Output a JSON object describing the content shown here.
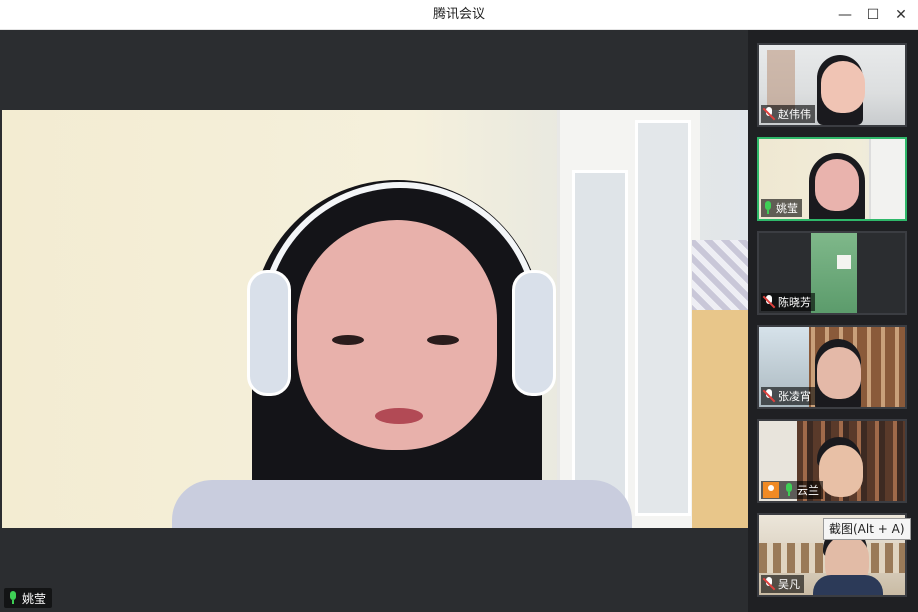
{
  "window": {
    "title": "腾讯会议",
    "minimize_glyph": "—",
    "maximize_glyph": "☐",
    "close_glyph": "✕"
  },
  "main_speaker": {
    "name": "姚莹",
    "mic_icon": "mic-on-icon"
  },
  "participants": [
    {
      "name": "赵伟伟",
      "mic": "muted"
    },
    {
      "name": "姚莹",
      "mic": "on",
      "active": true
    },
    {
      "name": "陈晓芳",
      "mic": "muted"
    },
    {
      "name": "张凌宵",
      "mic": "muted"
    },
    {
      "name": "云兰",
      "mic": "on",
      "host_icon": "avatar-icon"
    },
    {
      "name": "吴凡",
      "mic": "muted"
    }
  ],
  "tooltip": {
    "text": "截图(Alt + A)"
  },
  "colors": {
    "accent_active": "#2fb86a",
    "mic_on": "#3ecf55",
    "mic_muted": "#e0413d",
    "host_badge": "#f08a24"
  }
}
